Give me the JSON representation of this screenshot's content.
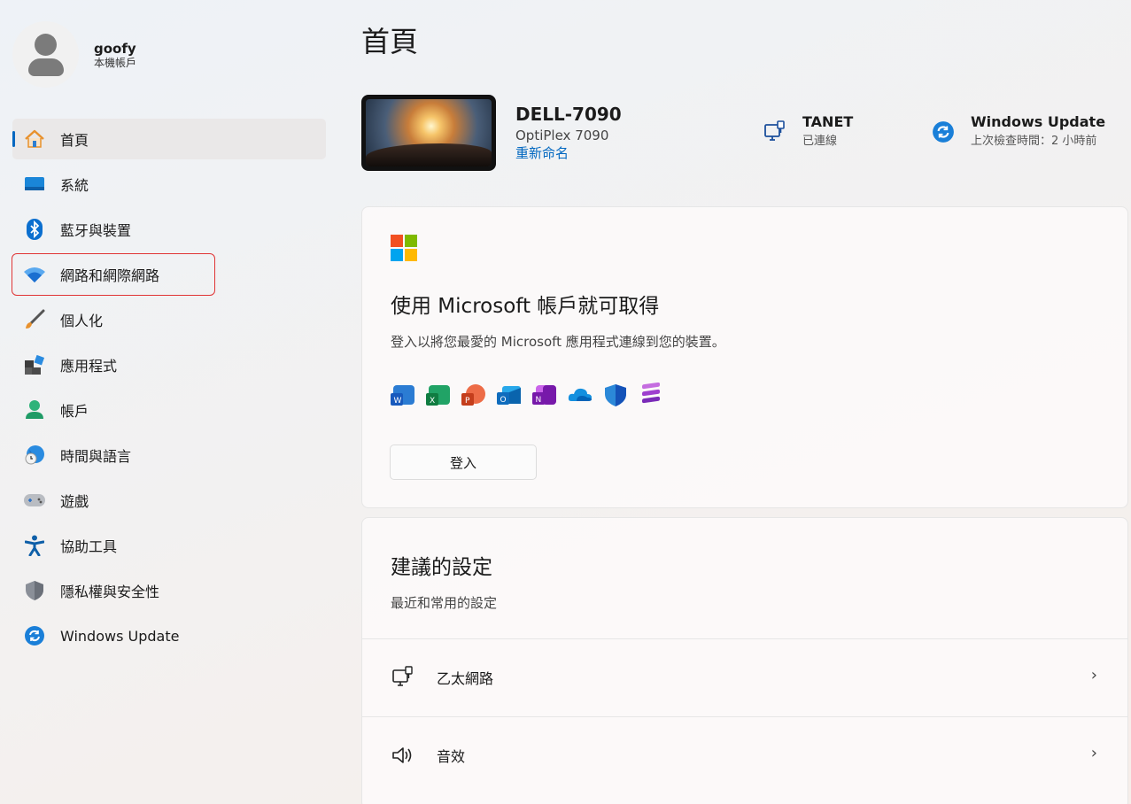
{
  "profile": {
    "name": "goofy",
    "sub": "本機帳戶"
  },
  "nav": {
    "home": "首頁",
    "system": "系統",
    "bluetooth": "藍牙與裝置",
    "network": "網路和網際網路",
    "personalization": "個人化",
    "apps": "應用程式",
    "accounts": "帳戶",
    "time": "時間與語言",
    "gaming": "遊戲",
    "accessibility": "協助工具",
    "privacy": "隱私權與安全性",
    "update": "Windows Update"
  },
  "main": {
    "title": "首頁",
    "device": {
      "name": "DELL-7090",
      "model": "OptiPlex 7090",
      "rename": "重新命名"
    },
    "network_status": {
      "title": "TANET",
      "sub": "已連線"
    },
    "update_status": {
      "title": "Windows Update",
      "sub": "上次檢查時間：2 小時前"
    },
    "ms_card": {
      "title": "使用 Microsoft 帳戶就可取得",
      "subtitle": "登入以將您最愛的 Microsoft 應用程式連線到您的裝置。",
      "signin": "登入",
      "app_icons": [
        "word-icon",
        "excel-icon",
        "powerpoint-icon",
        "outlook-icon",
        "onenote-icon",
        "onedrive-icon",
        "defender-icon",
        "clipchamp-icon"
      ]
    },
    "recommended": {
      "title": "建議的設定",
      "subtitle": "最近和常用的設定",
      "items": [
        {
          "label": "乙太網路",
          "icon": "ethernet-icon"
        },
        {
          "label": "音效",
          "icon": "speaker-icon"
        }
      ]
    }
  },
  "colors": {
    "accent": "#0067c0",
    "highlight_box": "#e03535"
  }
}
